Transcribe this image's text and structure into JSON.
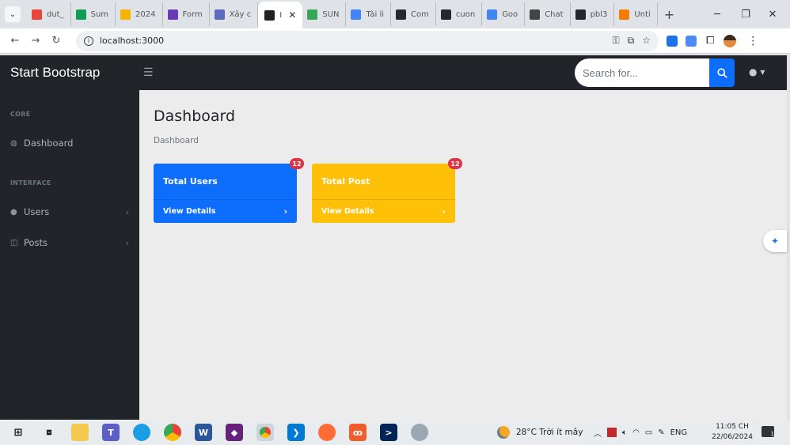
{
  "browser": {
    "tabs": [
      {
        "label": "dut_",
        "color": "#e8453c"
      },
      {
        "label": "Sum",
        "color": "#0f9d58"
      },
      {
        "label": "2024",
        "color": "#f4b400"
      },
      {
        "label": "Form",
        "color": "#673ab7"
      },
      {
        "label": "Xây c",
        "color": "#5c6bc0"
      },
      {
        "label": "I",
        "color": "#202124",
        "active": true
      },
      {
        "label": "SUN",
        "color": "#34a853"
      },
      {
        "label": "Tài li",
        "color": "#4285f4"
      },
      {
        "label": "Com",
        "color": "#24292e"
      },
      {
        "label": "cuon",
        "color": "#24292e"
      },
      {
        "label": "Goo",
        "color": "#4285f4"
      },
      {
        "label": "Chat",
        "color": "#444444"
      },
      {
        "label": "pbl3",
        "color": "#24292e"
      },
      {
        "label": "Unti",
        "color": "#f57c00"
      }
    ],
    "active_tab_close": "✕",
    "new_tab": "+",
    "url": "localhost:3000",
    "window_controls": {
      "minimize": "─",
      "restore": "❐",
      "close": "✕"
    }
  },
  "app": {
    "brand": "Start Bootstrap",
    "search_placeholder": "Search for...",
    "sidebar": {
      "core_heading": "CORE",
      "dashboard_label": "Dashboard",
      "interface_heading": "INTERFACE",
      "users_label": "Users",
      "posts_label": "Posts"
    },
    "main": {
      "title": "Dashboard",
      "breadcrumb": "Dashboard",
      "cards": [
        {
          "title": "Total Users",
          "link": "View Details",
          "badge": "12",
          "color": "#0d6efd"
        },
        {
          "title": "Total Post",
          "link": "View Details",
          "badge": "12",
          "color": "#ffc107"
        }
      ]
    }
  },
  "taskbar": {
    "weather_temp": "28°C",
    "weather_text": "Trời ít mây",
    "lang": "ENG",
    "time": "11:05 CH",
    "date": "22/06/2024",
    "notif_count": "1"
  }
}
